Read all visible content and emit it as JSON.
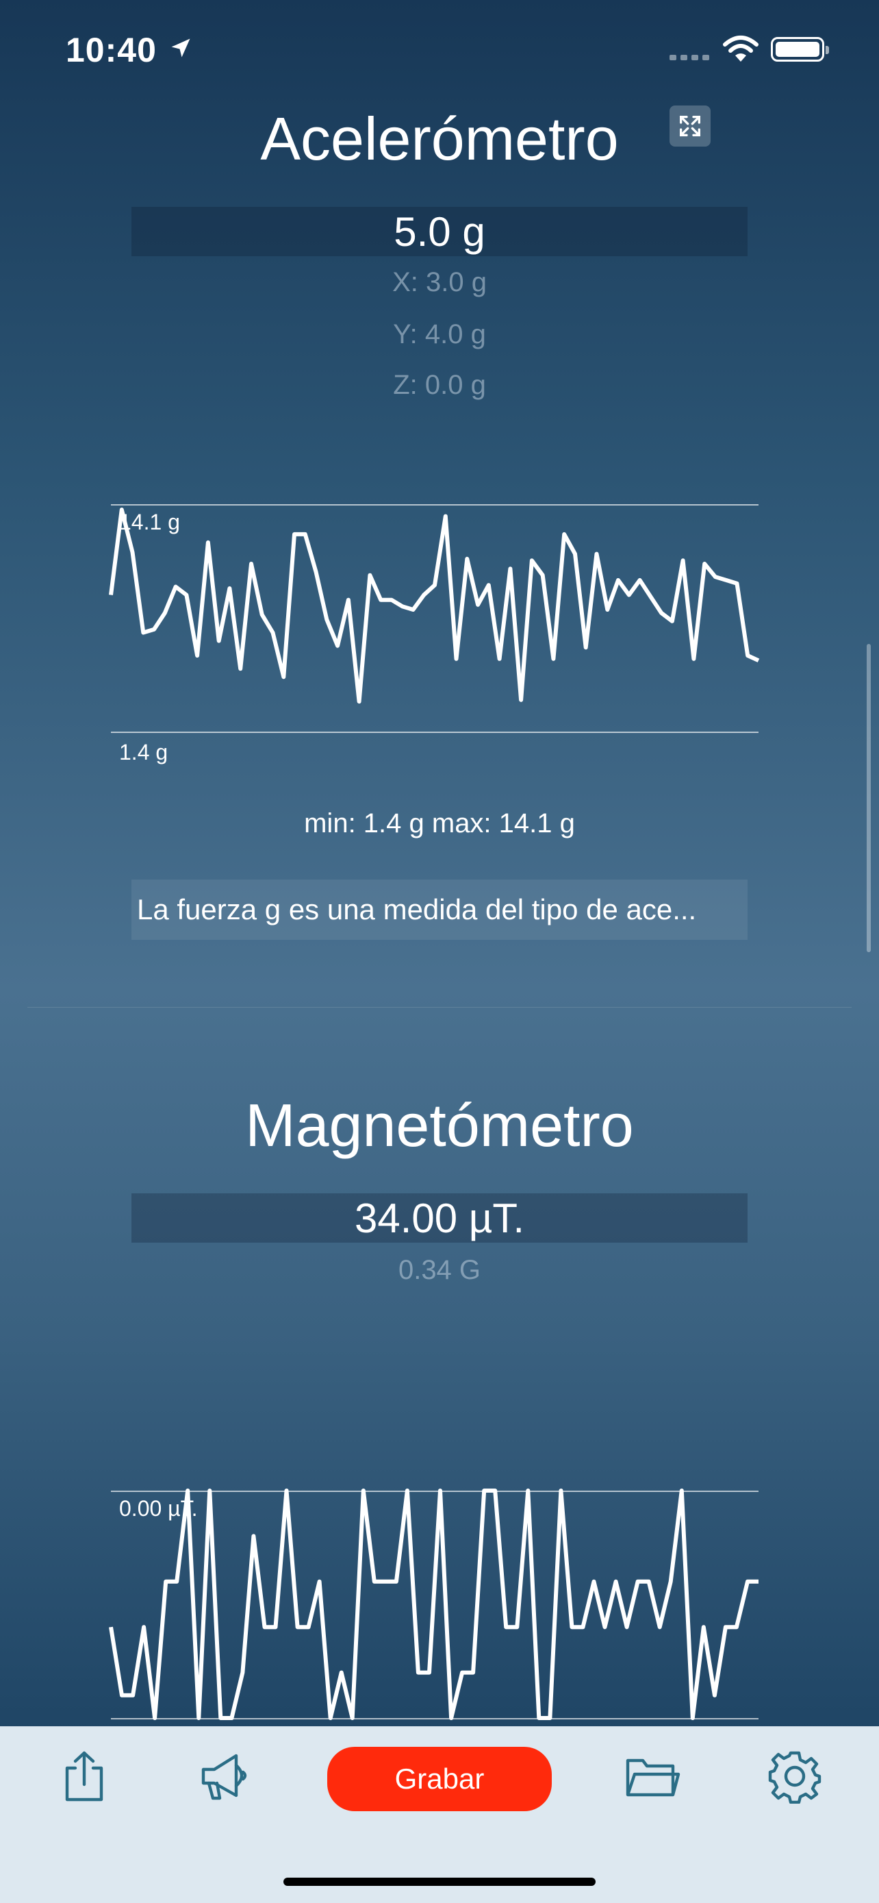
{
  "status_bar": {
    "time": "10:40"
  },
  "accelerometer": {
    "title": "Acelerómetro",
    "value": "5.0 g",
    "x": "X: 3.0 g",
    "y": "Y: 4.0 g",
    "z": "Z: 0.0 g",
    "chart_top_label": "14.1 g",
    "chart_bottom_label": "1.4 g",
    "minmax": "min: 1.4 g  max: 14.1 g",
    "description": "La fuerza g es una medida del tipo de ace..."
  },
  "magnetometer": {
    "title": "Magnetómetro",
    "value": "34.00  µT.",
    "secondary": "0.34  G",
    "chart_top_label": "0.00  µT."
  },
  "toolbar": {
    "record_label": "Grabar",
    "icons": [
      "share-icon",
      "megaphone-icon",
      "folder-icon",
      "gear-icon"
    ]
  },
  "chart_data": [
    {
      "type": "line",
      "ylim": [
        1.4,
        14.1
      ],
      "values": [
        8.9,
        14.1,
        11.5,
        6.6,
        6.8,
        7.8,
        9.4,
        8.9,
        5.2,
        12.1,
        6.1,
        9.3,
        4.4,
        10.8,
        7.7,
        6.6,
        3.9,
        12.6,
        12.6,
        10.3,
        7.4,
        5.8,
        8.6,
        2.4,
        10.1,
        8.6,
        8.6,
        8.2,
        8.0,
        8.9,
        9.5,
        13.7,
        5.0,
        11.1,
        8.3,
        9.5,
        5.0,
        10.5,
        2.5,
        11.0,
        10.1,
        5.0,
        12.6,
        11.4,
        5.7,
        11.4,
        8.0,
        9.8,
        8.9,
        9.8,
        8.8,
        7.8,
        7.3,
        11.0,
        5.0,
        10.8,
        10.0,
        9.8,
        9.6,
        5.2,
        4.9
      ]
    },
    {
      "type": "line",
      "values": [
        4,
        1,
        1,
        4,
        0,
        6,
        6,
        10,
        0,
        10,
        0,
        0,
        2,
        8,
        4,
        4,
        10,
        4,
        4,
        6,
        0,
        2,
        0,
        10,
        6,
        6,
        6,
        10,
        2,
        2,
        10,
        0,
        2,
        2,
        10,
        10,
        4,
        4,
        10,
        0,
        0,
        10,
        4,
        4,
        6,
        4,
        6,
        4,
        6,
        6,
        4,
        6,
        10,
        0,
        4,
        1,
        4,
        4,
        6,
        6
      ]
    }
  ]
}
